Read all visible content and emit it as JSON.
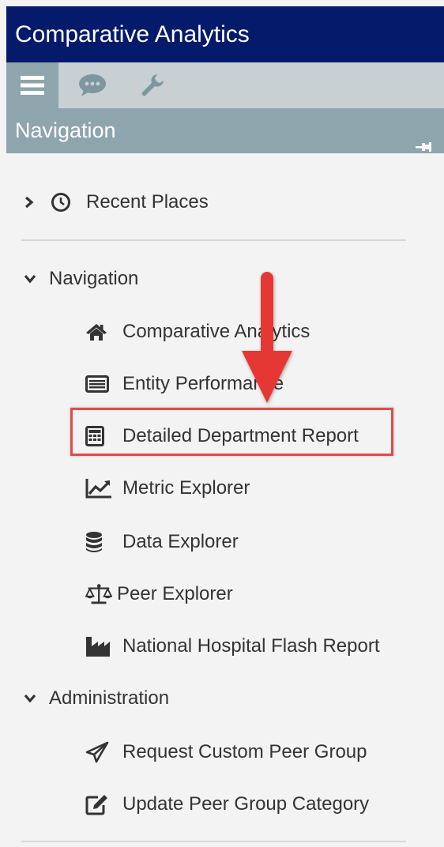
{
  "app": {
    "title": "Comparative Analytics"
  },
  "toolbar": {
    "items": [
      {
        "icon": "menu-icon",
        "active": true
      },
      {
        "icon": "chat-icon",
        "active": false
      },
      {
        "icon": "wrench-icon",
        "active": false
      }
    ]
  },
  "panel": {
    "title": "Navigation",
    "pin_icon": "pin-icon"
  },
  "recent": {
    "label": "Recent Places",
    "expanded": false,
    "icon": "clock-icon"
  },
  "navigation_section": {
    "label": "Navigation",
    "expanded": true,
    "items": [
      {
        "label": "Comparative Analytics",
        "icon": "home-icon"
      },
      {
        "label": "Entity Performance",
        "icon": "list-box-icon"
      },
      {
        "label": "Detailed Department Report",
        "icon": "calculator-icon",
        "highlighted": true
      },
      {
        "label": "Metric Explorer",
        "icon": "line-chart-icon"
      },
      {
        "label": "Data Explorer",
        "icon": "database-icon"
      },
      {
        "label": "Peer Explorer",
        "icon": "balance-scale-icon"
      },
      {
        "label": "National Hospital Flash Report",
        "icon": "industry-icon"
      }
    ]
  },
  "administration_section": {
    "label": "Administration",
    "expanded": true,
    "items": [
      {
        "label": "Request Custom Peer Group",
        "icon": "paper-plane-icon"
      },
      {
        "label": "Update Peer Group Category",
        "icon": "edit-icon"
      }
    ]
  },
  "colors": {
    "title_bar": "#061a6b",
    "toolbar": "#c8d0d4",
    "nav_header": "#8ea5ad",
    "highlight": "#e24a4a",
    "arrow": "#e53935"
  }
}
